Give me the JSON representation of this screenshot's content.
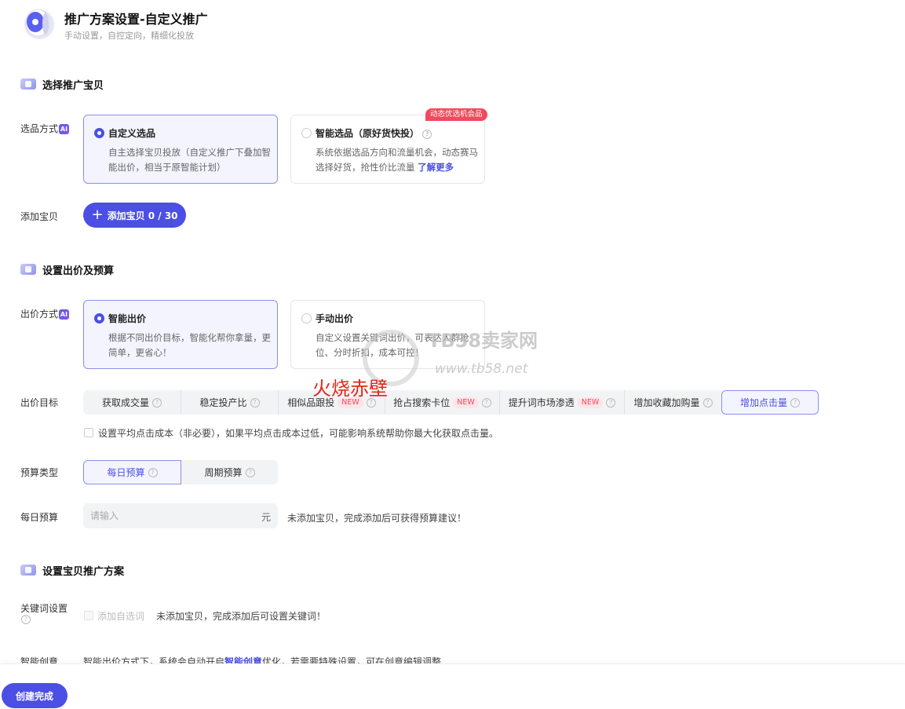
{
  "header": {
    "title": "推广方案设置-自定义推广",
    "subtitle": "手动设置，自控定向，精细化投放"
  },
  "section_product": {
    "title": "选择推广宝贝",
    "selection_label": "选品方式",
    "ai_badge": "AI",
    "options": [
      {
        "title": "自定义选品",
        "desc": "自主选择宝贝投放（自定义推广下叠加智能出价，相当于原智能计划）",
        "selected": true
      },
      {
        "title": "智能选品（原好货快投）",
        "desc": "系统依据选品方向和流量机会，动态赛马选择好货，抢性价比流量",
        "link": "了解更多",
        "tag": "动态优选机会品",
        "selected": false
      }
    ],
    "add_label": "添加宝贝",
    "add_button": "添加宝贝 0 / 30"
  },
  "section_bid": {
    "title": "设置出价及预算",
    "method_label": "出价方式",
    "ai_badge": "AI",
    "options": [
      {
        "title": "智能出价",
        "desc": "根据不同出价目标，智能化帮你拿量，更简单，更省心！",
        "selected": true
      },
      {
        "title": "手动出价",
        "desc": "自定义设置关键词出价，可表达人群抢位、分时折扣，成本可控！",
        "selected": false
      }
    ],
    "target_label": "出价目标",
    "targets": [
      {
        "label": "获取成交量",
        "new": ""
      },
      {
        "label": "稳定投产比",
        "new": ""
      },
      {
        "label": "相似品跟投",
        "new": "NEW"
      },
      {
        "label": "抢占搜索卡位",
        "new": "NEW"
      },
      {
        "label": "提升词市场渗透",
        "new": "NEW"
      },
      {
        "label": "增加收藏加购量",
        "new": ""
      },
      {
        "label": "增加点击量",
        "new": ""
      }
    ],
    "cpc_checkbox": "设置平均点击成本（非必要），如果平均点击成本过低，可能影响系统帮助你最大化获取点击量。",
    "budget_type_label": "预算类型",
    "budget_types": [
      "每日预算",
      "周期预算"
    ],
    "daily_budget_label": "每日预算",
    "budget_placeholder": "请输入",
    "budget_unit": "元",
    "budget_hint": "未添加宝贝，完成添加后可获得预算建议！"
  },
  "section_plan": {
    "title": "设置宝贝推广方案",
    "keyword_label": "关键词设置",
    "keyword_checkbox": "添加自选词",
    "keyword_hint": "未添加宝贝，完成添加后可设置关键词！",
    "creative_label": "智能创意",
    "creative_hint_pre": "智能出价方式下，系统会自动开启",
    "creative_link": "智能创意",
    "creative_hint_post": "优化，若需要特殊设置，可在创意编辑调整"
  },
  "watermark": {
    "site_name": "TB58卖家网",
    "site_url": "www.tb58.net",
    "overlay": "火烧赤壁"
  },
  "footer": {
    "create_button": "创建完成"
  },
  "colors": {
    "primary": "#4b4fe3",
    "selected_border": "#8c90ee",
    "selected_bg": "#f3f4fe",
    "tag_red": "#f2495c"
  }
}
